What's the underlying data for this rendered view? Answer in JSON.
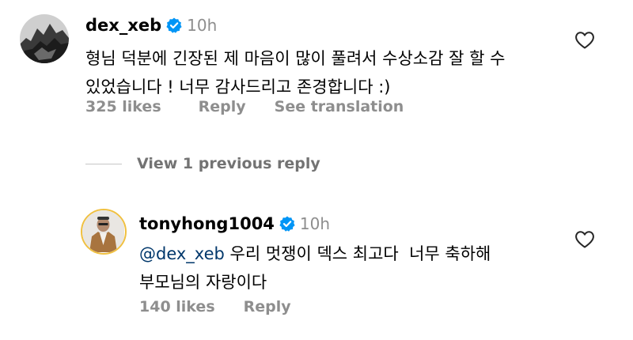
{
  "comment": {
    "username": "dex_xeb",
    "time": "10h",
    "text_line1": "형님 덕분에 긴장된 제 마음이 많이 풀려서 수상소감 잘 할 수",
    "text_line2": "있었습니다 ! 너무 감사드리고 존경합니다 :)",
    "likes": "325 likes",
    "reply_label": "Reply",
    "translate_label": "See translation"
  },
  "view_replies": {
    "label": "View 1 previous reply"
  },
  "reply": {
    "username": "tonyhong1004",
    "time": "10h",
    "mention": "@dex_xeb",
    "text_line1_rest": " 우리 멋쟁이 덱스 최고다  너무 축하해",
    "text_line2": "부모님의 자랑이다",
    "likes": "140 likes",
    "reply_label": "Reply"
  },
  "colors": {
    "verified_badge": "#0095f6",
    "meta_text": "#8e8e8e",
    "mention": "#00376b"
  },
  "icons": {
    "verified": "verified-badge-icon",
    "like": "heart-outline-icon"
  }
}
